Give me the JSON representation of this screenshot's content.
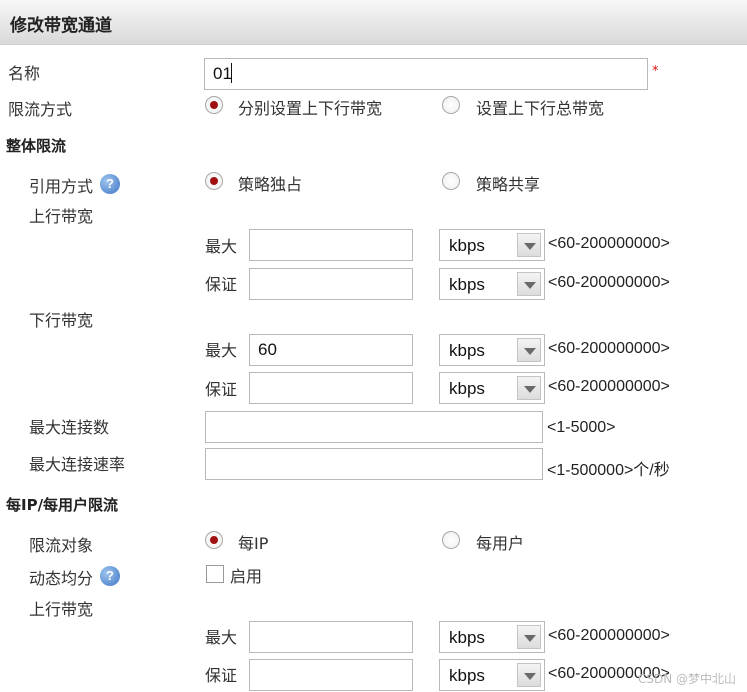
{
  "dialog": {
    "title": "修改带宽通道"
  },
  "form": {
    "name_label": "名称",
    "name_value": "01",
    "required_mark": "*",
    "limit_mode_label": "限流方式",
    "limit_mode_options": [
      "分别设置上下行带宽",
      "设置上下行总带宽"
    ],
    "limit_mode_selected": 0
  },
  "overall": {
    "section_title": "整体限流",
    "ref_mode_label": "引用方式",
    "ref_mode_options": [
      "策略独占",
      "策略共享"
    ],
    "up_label": "上行带宽",
    "down_label": "下行带宽",
    "max_label": "最大",
    "guarantee_label": "保证",
    "unit": "kbps",
    "bw_range": "<60-200000000>",
    "up_max_value": "",
    "up_guarantee_value": "",
    "down_max_value": "60",
    "down_guarantee_value": "",
    "max_conn_label": "最大连接数",
    "max_conn_range": "<1-5000>",
    "max_conn_rate_label": "最大连接速率",
    "max_conn_rate_range": "<1-500000>个/秒"
  },
  "peruser": {
    "section_title": "每IP/每用户限流",
    "target_label": "限流对象",
    "target_options": [
      "每IP",
      "每用户"
    ],
    "dyn_label": "动态均分",
    "enable_label": "启用",
    "up_label": "上行带宽",
    "max_label": "最大",
    "guarantee_label": "保证",
    "unit": "kbps",
    "bw_range": "<60-200000000>"
  },
  "help_glyph": "?",
  "icons": {
    "help": "help-icon",
    "select_arrow": "chevron-down-icon"
  },
  "colors": {
    "radio_selected": "#a01010",
    "help": "#3c74c6",
    "required": "#dd1111"
  },
  "watermark": "CSDN @梦中北山"
}
